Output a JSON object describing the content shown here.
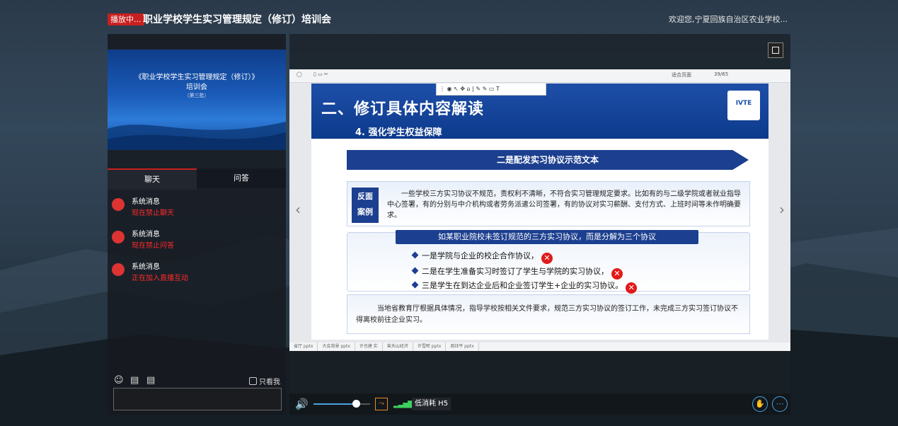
{
  "header": {
    "live_badge": "播放中...",
    "title": "职业学校学生实习管理规定（修订）培训会",
    "welcome": "欢迎您,宁夏回族自治区农业学校..."
  },
  "thumbnail": {
    "line1": "《职业学校学生实习管理规定（修订）》",
    "line2": "培训会",
    "line3": "（第三批）"
  },
  "tabs": {
    "chat": "聊天",
    "qa": "问答"
  },
  "messages": [
    {
      "sender": "系统消息",
      "text": "现在禁止聊天"
    },
    {
      "sender": "系统消息",
      "text": "现在禁止问答"
    },
    {
      "sender": "系统消息",
      "text": "正在加入直播互动"
    }
  ],
  "chat_bar": {
    "only_me": "只看我"
  },
  "ppt_toolbar": {
    "fit_label": "适合页面",
    "page": "39/65"
  },
  "slide": {
    "title": "二、修订具体内容解读",
    "subtitle": "4. 强化学生权益保障",
    "logo_text": "IVTE",
    "banner": "二是配发实习协议示范文本",
    "badge": "反面\n案例",
    "badge_line1": "反面",
    "badge_line2": "案例",
    "case_text": "一些学校三方实习协议不规范，责权利不清晰，不符合实习管理规定要求。比如有的与二级学院或者就业指导中心签署，有的分别与中介机构或者劳务派遣公司签署，有的协议对实习薪酬、支付方式、上班时间等未作明确要求。",
    "box2_header": "如某职业院校未签订规范的三方实习协议，而是分解为三个协议",
    "items": [
      "一是学院与企业的校企合作协议，",
      "二是在学生准备实习时签订了学生与学院的实习协议，",
      "三是学生在到达企业后和企业签订学生+企业的实习协议。"
    ],
    "conclusion": "当地省教育厅根据具体情况，指导学校按相关文件要求，规范三方实习协议的签订工作，未完成三方实习签订协议不得离校前往企业实习。"
  },
  "ppt_tabs": [
    "省厅 pptx",
    "大会背景 pptx",
    "许也建 实",
    "曾天山经济",
    "许雪晖 pptx",
    "周钰平 pptx"
  ],
  "controls": {
    "volume_level": 0.75,
    "quality": "低消耗 H5"
  },
  "colors": {
    "accent_red": "#c81f1f",
    "slide_blue": "#1c3f8f",
    "error_red": "#e01a1a"
  }
}
